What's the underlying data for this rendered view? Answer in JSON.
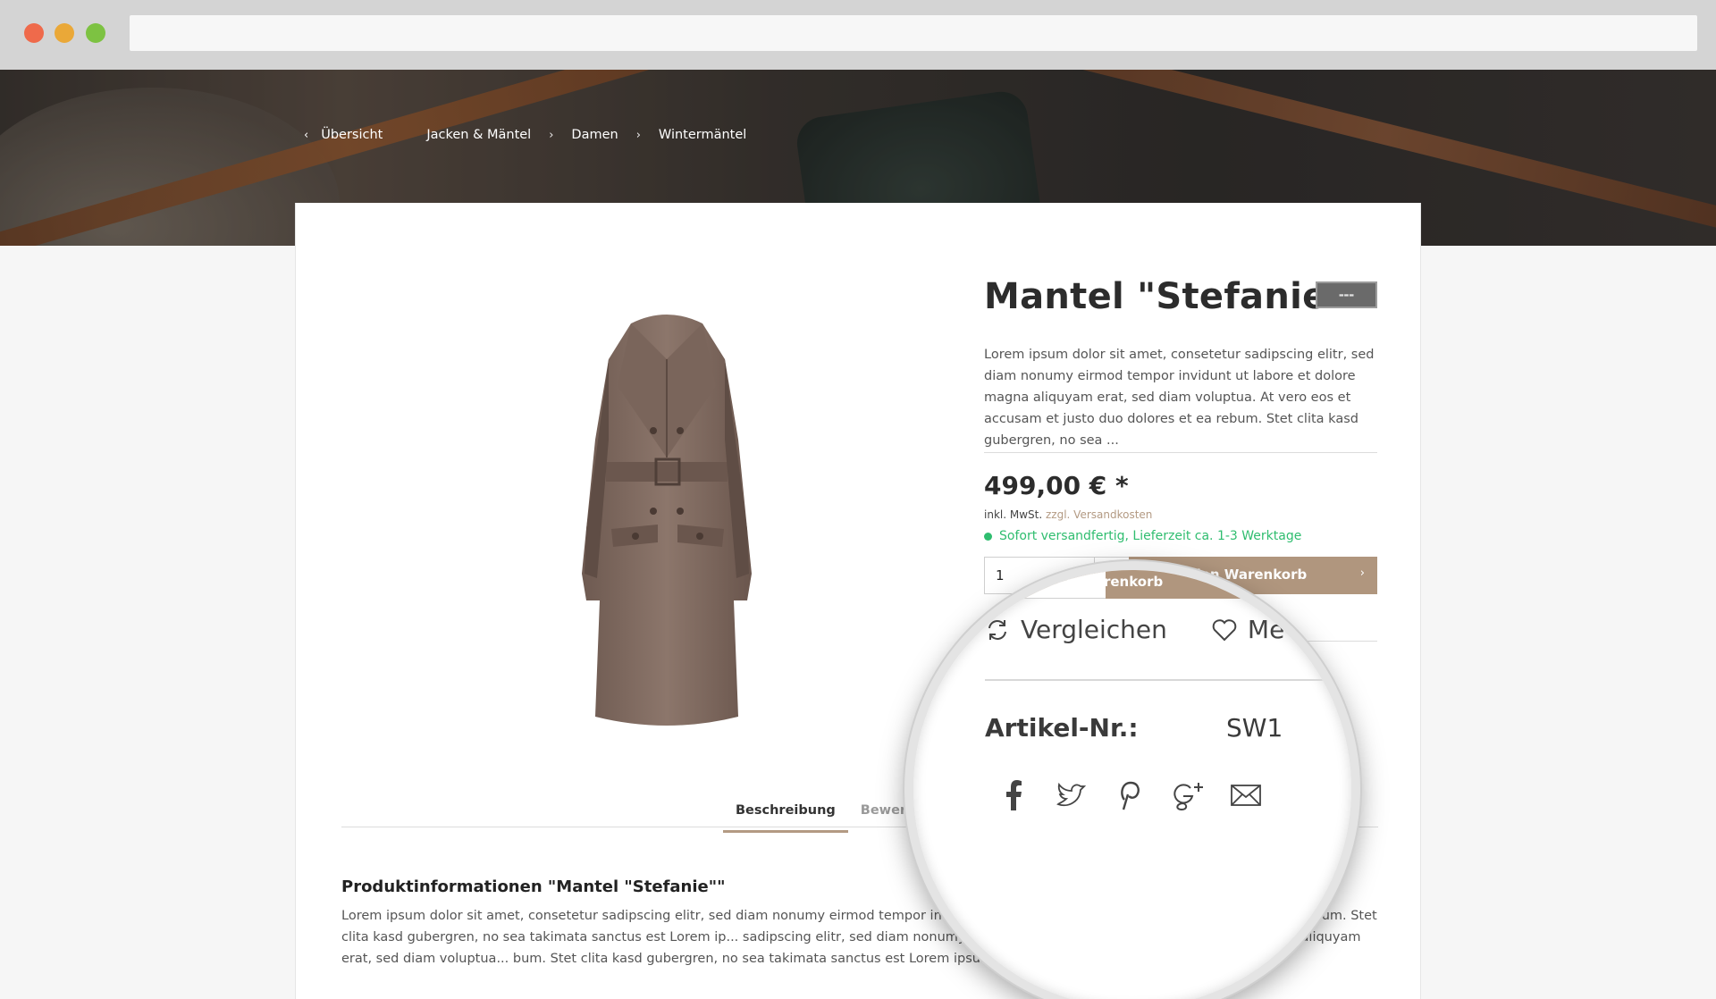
{
  "breadcrumb": {
    "items": [
      "Übersicht",
      "Jacken & Mäntel",
      "Damen",
      "Wintermäntel"
    ]
  },
  "product": {
    "title": "Mantel \"Stefanie\"",
    "short_description": "Lorem ipsum dolor sit amet, consetetur sadipscing elitr, sed diam nonumy eirmod tempor invidunt ut labore et dolore magna aliquyam erat, sed diam voluptua. At vero eos et accusam et justo duo dolores et ea rebum. Stet clita kasd gubergren, no sea ...",
    "price": "499,00 € *",
    "tax_note": "inkl. MwSt.",
    "shipping_link": "zzgl. Versandkosten",
    "delivery": "Sofort versandfertig, Lieferzeit ca. 1-3 Werktage",
    "quantity": "1",
    "cart_button_visible": "den Warenkorb"
  },
  "magnifier": {
    "cart_text": "den Warenkorb",
    "compare": "Vergleichen",
    "wishlist_partial": "Me",
    "article_label": "Artikel-Nr.:",
    "article_value": "SW1",
    "social_icons": [
      "facebook-icon",
      "twitter-icon",
      "pinterest-icon",
      "google-plus-icon",
      "mail-icon"
    ]
  },
  "tabs": [
    {
      "label": "Beschreibung",
      "active": true
    },
    {
      "label": "Bewert",
      "active": false
    }
  ],
  "info": {
    "title": "Produktinformationen \"Mantel \"Stefanie\"\"",
    "text": "Lorem ipsum dolor sit amet, consetetur sadipscing elitr, sed diam nonumy eirmod tempor invidunt ut l... eos et accusam et justo duo dolores et ea rebum. Stet clita kasd gubergren, no sea takimata sanctus est Lorem ip... sadipscing elitr, sed diam nonumy eirmod tempor invidunt ut labore et dolore magna aliquyam erat, sed diam voluptua... bum. Stet clita kasd gubergren, no sea takimata sanctus est Lorem ipsum dolor sit amet."
  },
  "colors": {
    "accent": "#b0967e",
    "delivery_green": "#2fbd6f"
  }
}
